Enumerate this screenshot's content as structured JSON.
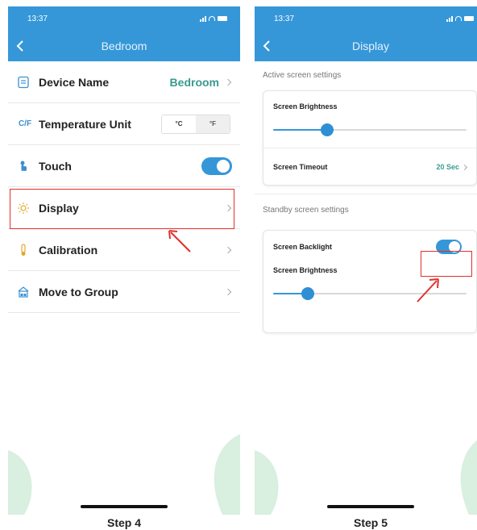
{
  "left": {
    "status_time": "13:37",
    "nav_title": "Bedroom",
    "rows": [
      {
        "label": "Device Name",
        "value": "Bedroom"
      },
      {
        "label": "Temperature Unit",
        "icon_text": "C/F",
        "options": [
          "°C",
          "°F"
        ]
      },
      {
        "label": "Touch",
        "toggle": true
      },
      {
        "label": "Display"
      },
      {
        "label": "Calibration"
      },
      {
        "label": "Move to Group"
      }
    ],
    "step_label": "Step 4"
  },
  "right": {
    "status_time": "13:37",
    "nav_title": "Display",
    "active_section": "Active screen settings",
    "active_brightness_label": "Screen Brightness",
    "active_brightness_level": 0.28,
    "timeout_label": "Screen Timeout",
    "timeout_value": "20 Sec",
    "standby_section": "Standby screen settings",
    "backlight_label": "Screen Backlight",
    "backlight_on": true,
    "standby_brightness_label": "Screen Brightness",
    "standby_brightness_level": 0.18,
    "step_label": "Step 5"
  },
  "colors": {
    "brand_blue": "#3597d8",
    "accent_teal": "#3a9a8f",
    "highlight_red": "#e0302b",
    "leaf_green": "#d9efe0"
  },
  "icons": [
    "document-icon",
    "temperature-unit-icon",
    "touch-icon",
    "sun-icon",
    "thermometer-icon",
    "group-icon",
    "back-arrow-icon",
    "chevron-right-icon"
  ]
}
